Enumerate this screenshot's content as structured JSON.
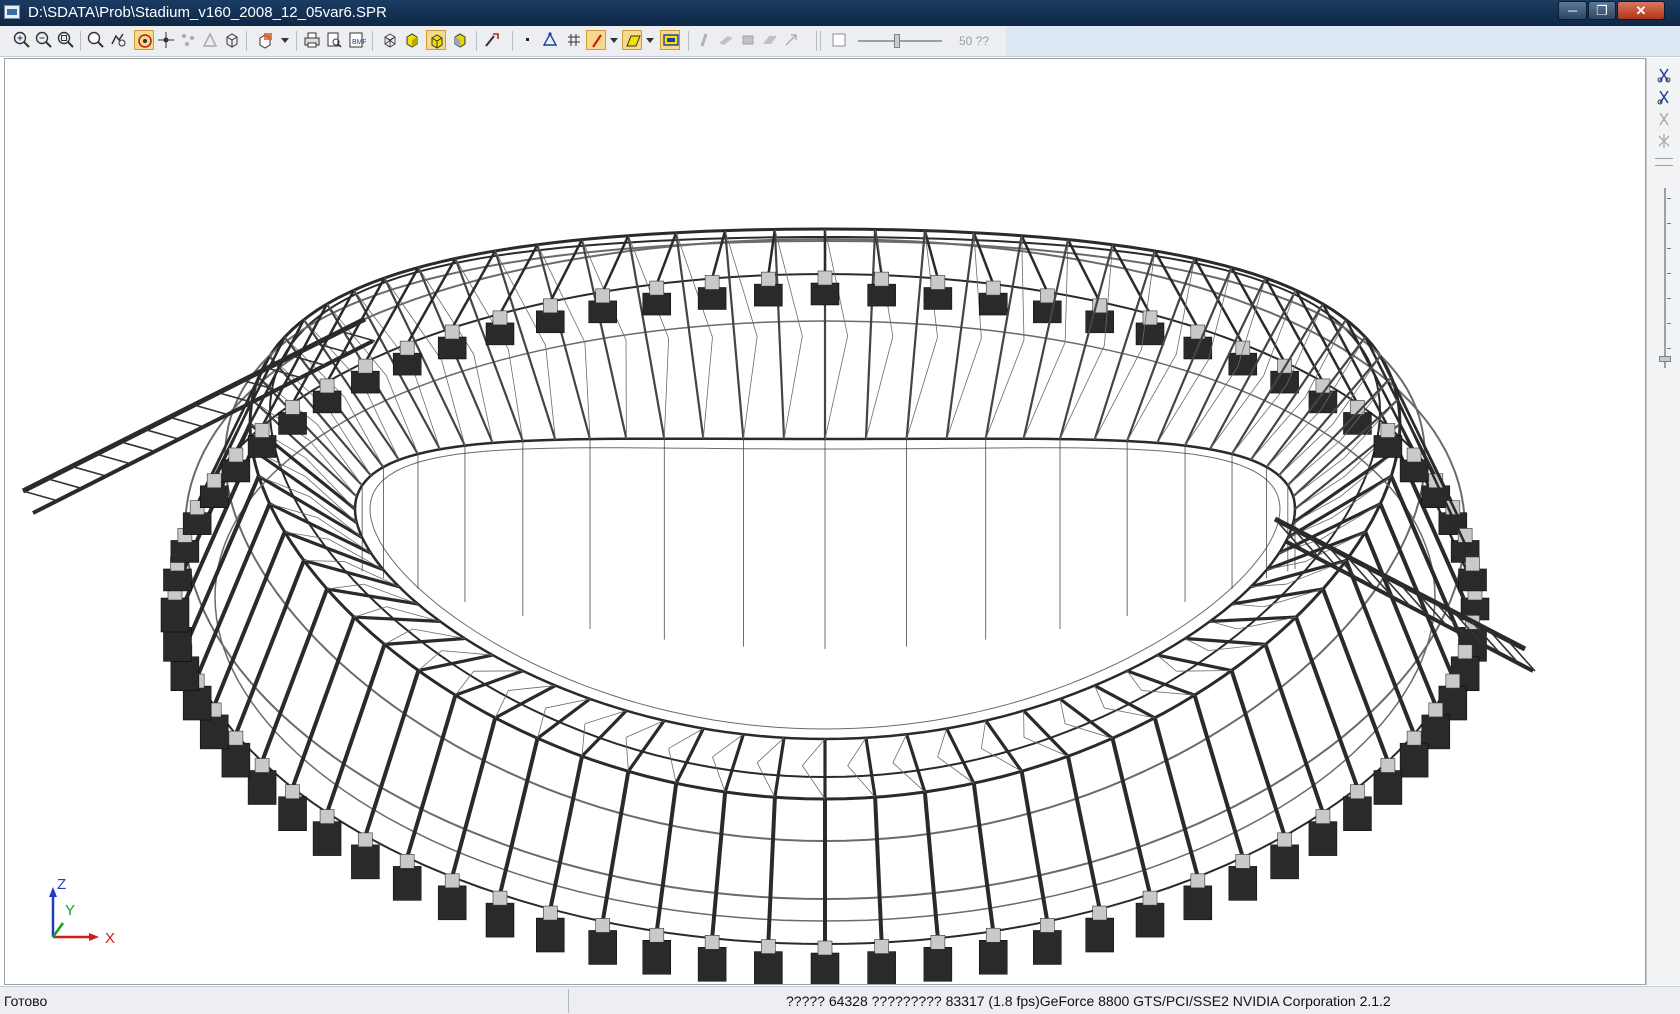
{
  "window": {
    "title": "D:\\SDATA\\Prob\\Stadium_v160_2008_12_05var6.SPR",
    "minimize_label": "─",
    "maximize_label": "❐",
    "close_label": "✕"
  },
  "toolbar": {
    "buttons": [
      {
        "name": "zoom-in-icon"
      },
      {
        "name": "zoom-out-icon"
      },
      {
        "name": "zoom-fit-icon"
      },
      {
        "name": "zoom-window-icon"
      },
      {
        "name": "pan-icon"
      },
      {
        "name": "rotate-icon"
      },
      {
        "name": "select-node-icon"
      },
      {
        "name": "node-filter-icon"
      },
      {
        "name": "element-filter-icon"
      },
      {
        "name": "cube-icon"
      },
      {
        "name": "view-dropdown-icon"
      },
      {
        "name": "print-icon"
      },
      {
        "name": "print-preview-icon"
      },
      {
        "name": "export-icon"
      },
      {
        "name": "wireframe-icon"
      },
      {
        "name": "shaded-cube-icon"
      },
      {
        "name": "solid-cube-icon"
      },
      {
        "name": "shaded-cube-alt-icon"
      },
      {
        "name": "tools-icon"
      },
      {
        "name": "point-icon"
      },
      {
        "name": "triangle-icon"
      },
      {
        "name": "grid-icon"
      },
      {
        "name": "pencil-icon"
      },
      {
        "name": "fill-icon"
      },
      {
        "name": "display-icon"
      },
      {
        "name": "bar-icon"
      },
      {
        "name": "plate-icon"
      },
      {
        "name": "solid-icon"
      },
      {
        "name": "shell-icon"
      },
      {
        "name": "arrow-icon"
      }
    ],
    "zoom_value": "50 ??"
  },
  "rightbar": {
    "buttons": [
      {
        "name": "cut-icon-1"
      },
      {
        "name": "cut-icon-2"
      },
      {
        "name": "cut-icon-3"
      },
      {
        "name": "cut-icon-4"
      }
    ]
  },
  "viewport": {
    "axes": {
      "z": "Z",
      "y": "Y",
      "x": "X"
    },
    "colors": {
      "dark": "#2a2a2a",
      "mid": "#6b6b6b",
      "light": "#c9c9c9",
      "axis_z": "#1f3cc4",
      "axis_y": "#19a019",
      "axis_x": "#d11a1a"
    }
  },
  "status": {
    "left": "Готово",
    "right": "????? 64328  ????????? 83317  (1.8 fps)GeForce 8800 GTS/PCI/SSE2 NVIDIA Corporation 2.1.2"
  }
}
